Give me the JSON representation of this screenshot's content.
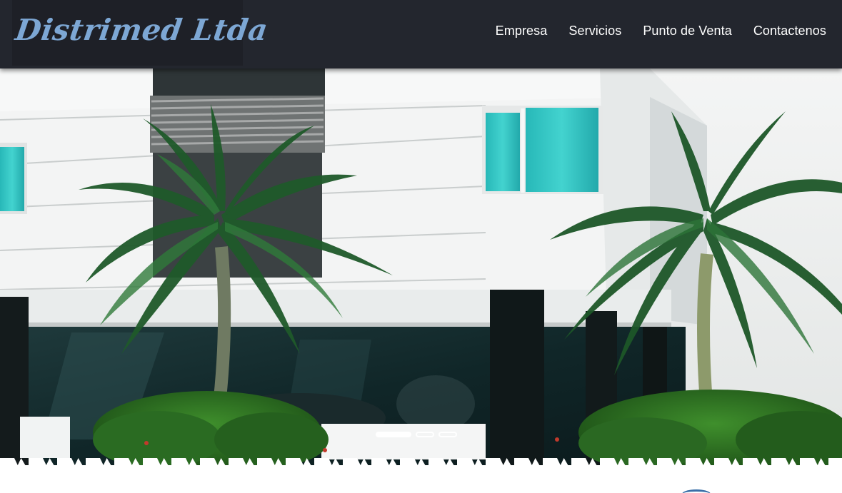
{
  "header": {
    "logo_text": "Distrimed Ltda",
    "nav": [
      {
        "label": "Empresa"
      },
      {
        "label": "Servicios"
      },
      {
        "label": "Punto de Venta"
      },
      {
        "label": "Contactenos"
      }
    ]
  },
  "slider": {
    "slide_count": 3,
    "active_slide": 1
  },
  "colors": {
    "header_bg": "#23262e",
    "logo": "#7da7d4",
    "accent_glass": "#2bbfc0"
  }
}
